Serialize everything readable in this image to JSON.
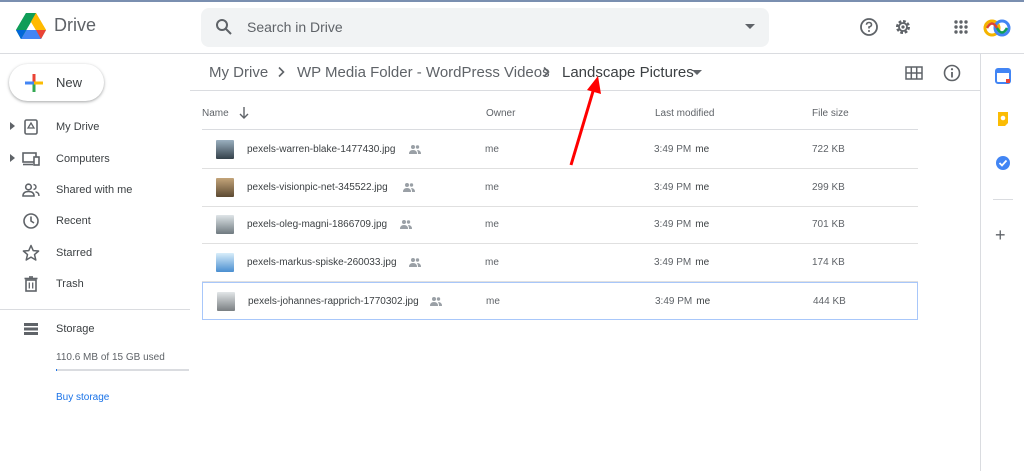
{
  "app": {
    "name": "Drive"
  },
  "search": {
    "placeholder": "Search in Drive"
  },
  "header_icons": [
    "help-icon",
    "settings-icon",
    "apps-grid-icon",
    "account-avatar"
  ],
  "sidebar": {
    "new_label": "New",
    "items": [
      {
        "label": "My Drive",
        "icon": "my-drive-icon",
        "expandable": true
      },
      {
        "label": "Computers",
        "icon": "computers-icon",
        "expandable": true
      },
      {
        "label": "Shared with me",
        "icon": "shared-with-me-icon",
        "expandable": false
      },
      {
        "label": "Recent",
        "icon": "clock-icon",
        "expandable": false
      },
      {
        "label": "Starred",
        "icon": "star-icon",
        "expandable": false
      },
      {
        "label": "Trash",
        "icon": "trash-icon",
        "expandable": false
      }
    ],
    "storage": {
      "label": "Storage",
      "used_text": "110.6 MB of 15 GB used",
      "used_fraction": 0.0074,
      "buy_label": "Buy storage"
    }
  },
  "breadcrumb": {
    "items": [
      "My Drive",
      "WP Media Folder - WordPress Videos",
      "Landscape Pictures"
    ]
  },
  "table": {
    "columns": {
      "name": "Name",
      "owner": "Owner",
      "modified": "Last modified",
      "size": "File size"
    },
    "rows": [
      {
        "name": "pexels-warren-blake-1477430.jpg",
        "owner": "me",
        "time": "3:49 PM",
        "by": "me",
        "size": "722 KB",
        "selected": false
      },
      {
        "name": "pexels-visionpic-net-345522.jpg",
        "owner": "me",
        "time": "3:49 PM",
        "by": "me",
        "size": "299 KB",
        "selected": false
      },
      {
        "name": "pexels-oleg-magni-1866709.jpg",
        "owner": "me",
        "time": "3:49 PM",
        "by": "me",
        "size": "701 KB",
        "selected": false
      },
      {
        "name": "pexels-markus-spiske-260033.jpg",
        "owner": "me",
        "time": "3:49 PM",
        "by": "me",
        "size": "174 KB",
        "selected": false
      },
      {
        "name": "pexels-johannes-rapprich-1770302.jpg",
        "owner": "me",
        "time": "3:49 PM",
        "by": "me",
        "size": "444 KB",
        "selected": true
      }
    ]
  },
  "side_panel": {
    "apps": [
      "calendar-icon",
      "keep-icon",
      "tasks-icon"
    ]
  },
  "colors": {
    "accent": "#1a73e8",
    "annotation": "#ff0000",
    "selection_border": "#a8c7fa"
  }
}
